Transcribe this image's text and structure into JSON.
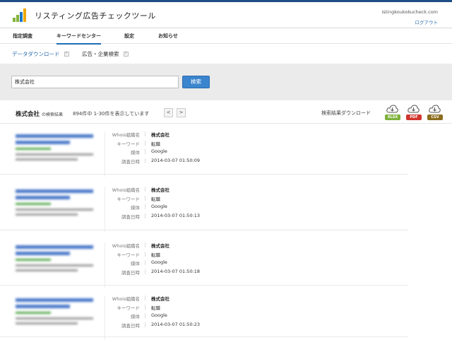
{
  "header": {
    "app_title": "リスティング広告チェックツール",
    "site": "istingkoukokucheck.com",
    "logout": "ログアウト"
  },
  "nav": {
    "items": [
      {
        "label": "指定調査"
      },
      {
        "label": "キーワードセンター"
      },
      {
        "label": "設定"
      },
      {
        "label": "お知らせ"
      }
    ],
    "active": "キーワードセンター"
  },
  "subnav": {
    "items": [
      {
        "label": "データダウンロード",
        "help": "?"
      },
      {
        "label": "広告・企業検索",
        "help": "?"
      }
    ]
  },
  "search": {
    "value": "株式会社",
    "button": "検索"
  },
  "results_header": {
    "keyword": "株式会社",
    "suffix": "の検索結果",
    "count_text": "894件中 1-30件を表示しています",
    "prev": "<",
    "next": ">",
    "download_label": "検索結果ダウンロード",
    "downloads": [
      {
        "label": "XLSX",
        "color": "#7cb13a"
      },
      {
        "label": "PDF",
        "color": "#d0342c"
      },
      {
        "label": "CSV",
        "color": "#8b6d1d"
      }
    ]
  },
  "field_labels": {
    "whois": "Whois組織名",
    "keyword": "キーワード",
    "media": "媒体",
    "date": "調査日時"
  },
  "results": [
    {
      "whois": "株式会社",
      "keyword": "転職",
      "media": "Google",
      "date": "2014-03-07 01:50:09"
    },
    {
      "whois": "株式会社",
      "keyword": "転職",
      "media": "Google",
      "date": "2014-03-07 01:50:13"
    },
    {
      "whois": "株式会社",
      "keyword": "転職",
      "media": "Google",
      "date": "2014-03-07 01:50:18"
    },
    {
      "whois": "株式会社",
      "keyword": "転職",
      "media": "Google",
      "date": "2014-03-07 01:50:23"
    }
  ]
}
